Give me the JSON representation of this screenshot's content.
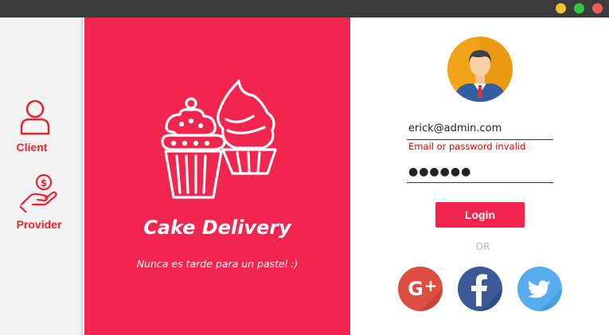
{
  "window": {
    "controls": [
      "minimize",
      "maximize",
      "close"
    ]
  },
  "sidebar": {
    "items": [
      {
        "label": "Client",
        "icon": "user-icon"
      },
      {
        "label": "Provider",
        "icon": "hand-coin-icon"
      }
    ],
    "accent_color": "#e8262d"
  },
  "hero": {
    "title": "Cake Delivery",
    "tagline": "Nunca es tarde para un pastel :)",
    "icon": "cupcake-icon",
    "background": "#f0264f"
  },
  "login": {
    "avatar_icon": "businessman-avatar-icon",
    "email_value": "erick@admin.com",
    "error_message": "Email or password invalid",
    "password_value": "●●●●●●",
    "login_label": "Login",
    "or_label": "OR",
    "social": [
      {
        "name": "google-plus",
        "icon": "google-plus-icon",
        "color": "#dc4e41"
      },
      {
        "name": "facebook",
        "icon": "facebook-icon",
        "color": "#3b5998"
      },
      {
        "name": "twitter",
        "icon": "twitter-icon",
        "color": "#55acee"
      }
    ]
  }
}
